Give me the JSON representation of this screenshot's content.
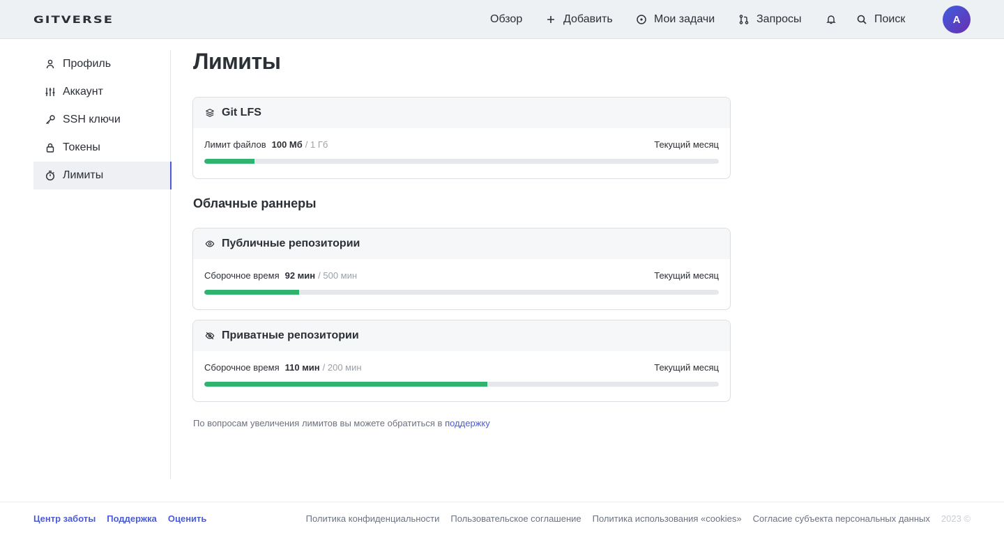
{
  "header": {
    "logo": "GITVERSE",
    "nav": {
      "overview": "Обзор",
      "add": "Добавить",
      "tasks": "Мои задачи",
      "requests": "Запросы",
      "search": "Поиск"
    },
    "avatar_letter": "A"
  },
  "sidebar": {
    "items": [
      {
        "label": "Профиль",
        "icon": "user-icon"
      },
      {
        "label": "Аккаунт",
        "icon": "sliders-icon"
      },
      {
        "label": "SSH ключи",
        "icon": "key-icon"
      },
      {
        "label": "Токены",
        "icon": "lock-icon"
      },
      {
        "label": "Лимиты",
        "icon": "stopwatch-icon",
        "active": true
      }
    ]
  },
  "main": {
    "title": "Лимиты",
    "lfs": {
      "title": "Git LFS",
      "label": "Лимит файлов",
      "used": "100 Мб",
      "total": "/ 1 Гб",
      "period": "Текущий месяц",
      "progress": 0.0977
    },
    "runners_title": "Облачные раннеры",
    "public": {
      "title": "Публичные репозитории",
      "label": "Сборочное время",
      "used": "92 мин",
      "total": "/ 500 мин",
      "period": "Текущий месяц",
      "progress": 0.184
    },
    "private": {
      "title": "Приватные репозитории",
      "label": "Сборочное время",
      "used": "110 мин",
      "total": "/ 200 мин",
      "period": "Текущий месяц",
      "progress": 0.55
    },
    "help_text": "По вопросам увеличения лимитов вы можете обратиться в ",
    "help_link": "поддержку"
  },
  "footer": {
    "left": {
      "care": "Центр заботы",
      "support": "Поддержка",
      "rate": "Оценить"
    },
    "right": {
      "privacy": "Политика конфиденциальности",
      "agreement": "Пользовательское соглашение",
      "cookies": "Политика использования «cookies»",
      "consent": "Согласие субъекта персональных данных",
      "copyright": "2023 ©"
    }
  },
  "colors": {
    "accent": "#4b5bd6",
    "progress": "#2fb36e",
    "track": "#e5e7eb"
  }
}
